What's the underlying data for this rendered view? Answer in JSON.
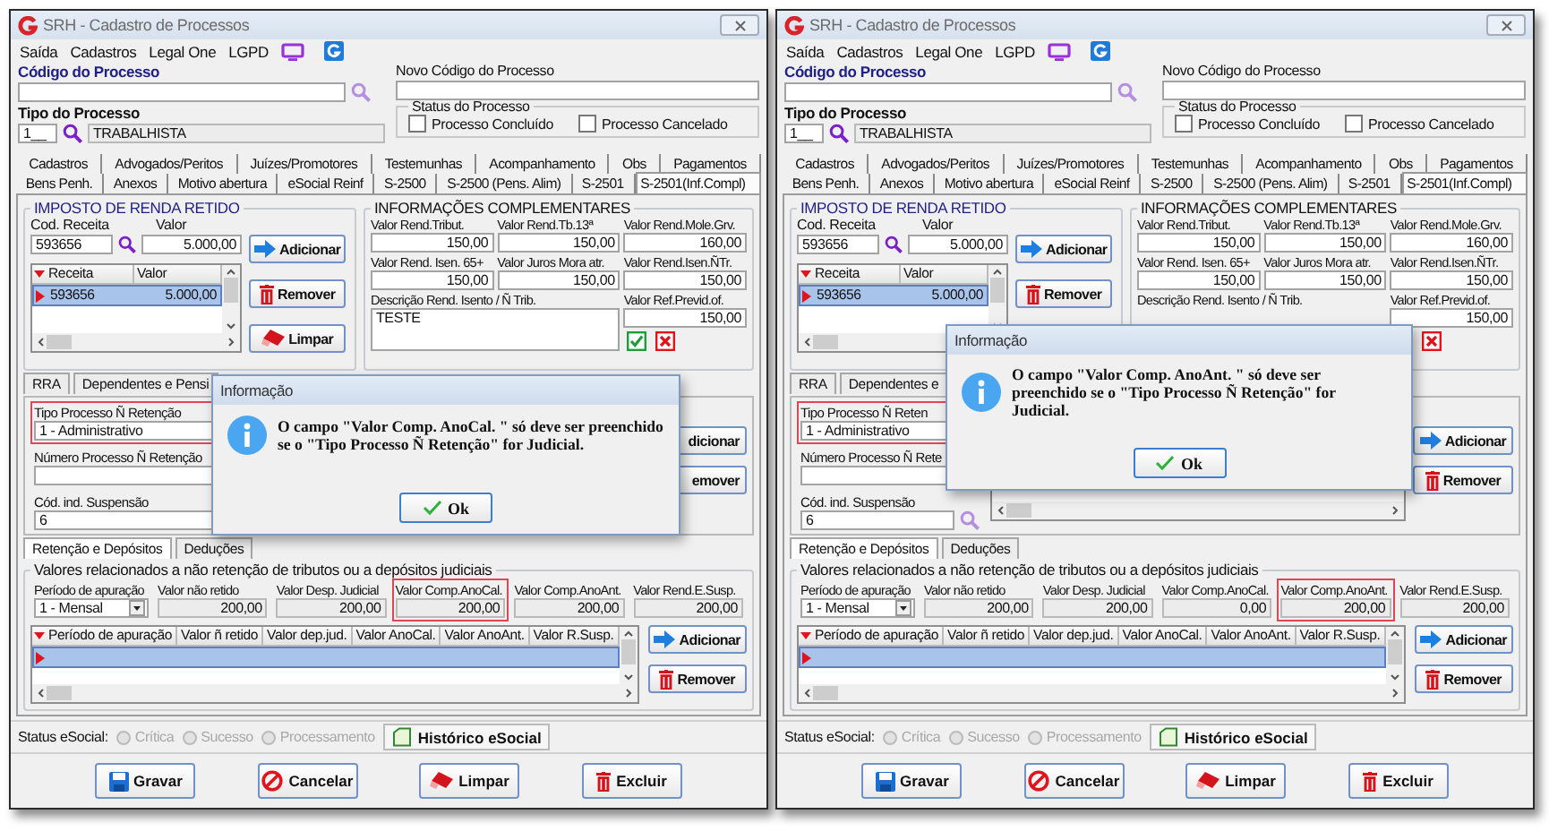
{
  "windows": [
    {
      "title": "SRH - Cadastro de Processos",
      "menu": [
        {
          "label": "Saída"
        },
        {
          "label": "Cadastros"
        },
        {
          "label": "Legal One"
        },
        {
          "label": "LGPD"
        }
      ],
      "process_code": {
        "label": "Código do Processo"
      },
      "new_code": {
        "label": "Novo Código do Processo"
      },
      "process_type": {
        "label": "Tipo do Processo",
        "code": "1__",
        "name": "TRABALHISTA"
      },
      "status_group": {
        "title": "Status do Processo",
        "options": [
          {
            "label": "Processo Concluído",
            "checked": false
          },
          {
            "label": "Processo Cancelado",
            "checked": false
          }
        ]
      },
      "tabs": [
        [
          {
            "label": "Cadastros",
            "selected": false
          },
          {
            "label": "Advogados/Peritos",
            "selected": false
          },
          {
            "label": "Juízes/Promotores",
            "selected": false
          },
          {
            "label": "Testemunhas",
            "selected": false
          },
          {
            "label": "Acompanhamento",
            "selected": false
          },
          {
            "label": "Obs",
            "selected": false
          },
          {
            "label": "Pagamentos",
            "selected": false
          }
        ],
        [
          {
            "label": "Bens Penh.",
            "selected": false
          },
          {
            "label": "Anexos",
            "selected": false
          },
          {
            "label": "Motivo abertura",
            "selected": false
          },
          {
            "label": "eSocial Reinf",
            "selected": false
          },
          {
            "label": "S-2500",
            "selected": false
          },
          {
            "label": "S-2500 (Pens. Alim)",
            "selected": false
          },
          {
            "label": "S-2501",
            "selected": false
          },
          {
            "label": "S-2501(Inf.Compl)",
            "selected": true
          }
        ]
      ],
      "income_tax": {
        "title": "IMPOSTO DE RENDA RETIDO",
        "code_label": "Cod. Receita",
        "code": "593656",
        "value_label": "Valor",
        "value": "5.000,00",
        "columns": [
          "Receita",
          "Valor"
        ],
        "rows": [
          {
            "cells": [
              "593656",
              "5.000,00"
            ],
            "selected": true
          }
        ],
        "buttons": [
          {
            "kind": "add",
            "label": "Adicionar"
          },
          {
            "kind": "remove",
            "label": "Remover"
          },
          {
            "kind": "clear",
            "label": "Limpar"
          }
        ]
      },
      "complementary": {
        "title": "INFORMAÇÕES COMPLEMENTARES",
        "fields": [
          {
            "label": "Valor Rend.Tribut.",
            "value": "150,00"
          },
          {
            "label": "Valor Rend.Tb.13ª",
            "value": "150,00"
          },
          {
            "label": "Valor Rend.Mole.Grv.",
            "value": "160,00"
          },
          {
            "label": "Valor Rend. Isen. 65+",
            "value": "150,00"
          },
          {
            "label": "Valor Juros Mora atr.",
            "value": "150,00"
          },
          {
            "label": "Valor Rend.Isen.ÑTr.",
            "value": "150,00"
          }
        ],
        "description": {
          "label": "Descrição Rend. Isento / Ñ Trib.",
          "value": "TESTE"
        },
        "previd": {
          "label": "Valor Ref.Previd.of.",
          "value": "150,00"
        },
        "actions": [
          {
            "kind": "confirm"
          },
          {
            "kind": "cancel"
          }
        ]
      },
      "subtabs": [
        {
          "label": "RRA",
          "selected": false
        },
        {
          "label": "Dependentes e Pensi",
          "selected": false
        }
      ],
      "retention": {
        "fields": [
          {
            "label": "Tipo Processo Ñ Retenção",
            "value": "1 - Administrativo",
            "highlighted": true
          },
          {
            "label": "Número Processo Ñ Retenção",
            "highlighted": false
          },
          {
            "label": "Cód. ind. Suspensão",
            "value": "6",
            "highlighted": false
          }
        ],
        "buttons": [
          {
            "label": "dicionar"
          },
          {
            "label": "emover"
          }
        ]
      },
      "subtabs2": [
        {
          "label": "Retenção e Depósitos",
          "selected": true
        },
        {
          "label": "Deduções",
          "selected": false
        }
      ],
      "values": {
        "title": "Valores relacionados a não retenção de tributos ou a depósitos judiciais",
        "period": {
          "label": "Período de apuração",
          "value": "1 - Mensal"
        },
        "fields": [
          {
            "label": "Valor não retido",
            "value": "200,00",
            "highlighted": false
          },
          {
            "label": "Valor Desp. Judicial",
            "value": "200,00",
            "highlighted": false
          },
          {
            "label": "Valor Comp.AnoCal.",
            "value": "200,00",
            "highlighted": true
          },
          {
            "label": "Valor Comp.AnoAnt.",
            "value": "200,00",
            "highlighted": false
          },
          {
            "label": "Valor Rend.E.Susp.",
            "value": "200,00",
            "highlighted": false
          }
        ],
        "columns": [
          "Período de apuração",
          "Valor ñ retido",
          "Valor dep.jud.",
          "Valor AnoCal.",
          "Valor AnoAnt.",
          "Valor R.Susp."
        ],
        "rows": [
          {
            "selected": true
          }
        ],
        "buttons": [
          {
            "kind": "add",
            "label": "Adicionar"
          },
          {
            "kind": "remove",
            "label": "Remover"
          }
        ]
      },
      "status_bar": {
        "label": "Status eSocial:",
        "options": [
          {
            "label": "Crítica",
            "selected": false,
            "disabled": true
          },
          {
            "label": "Sucesso",
            "selected": false,
            "disabled": true
          },
          {
            "label": "Processamento",
            "selected": false,
            "disabled": true
          }
        ],
        "history_button": "Histórico eSocial"
      },
      "actions": [
        {
          "kind": "save",
          "label": "Gravar"
        },
        {
          "kind": "cancel",
          "label": "Cancelar"
        },
        {
          "kind": "clear",
          "label": "Limpar"
        },
        {
          "kind": "delete",
          "label": "Excluir"
        }
      ],
      "dialog": {
        "title": "Informação",
        "message": "O campo \"Valor Comp. AnoCal. \" só deve ser preenchido se o \"Tipo Processo Ñ Retenção\" for Judicial.",
        "button": "Ok"
      }
    },
    {
      "title": "SRH - Cadastro de Processos",
      "menu": [
        {
          "label": "Saída"
        },
        {
          "label": "Cadastros"
        },
        {
          "label": "Legal One"
        },
        {
          "label": "LGPD"
        }
      ],
      "process_code": {
        "label": "Código do Processo"
      },
      "new_code": {
        "label": "Novo Código do Processo"
      },
      "process_type": {
        "label": "Tipo do Processo",
        "code": "1__",
        "name": "TRABALHISTA"
      },
      "status_group": {
        "title": "Status do Processo",
        "options": [
          {
            "label": "Processo Concluído",
            "checked": false
          },
          {
            "label": "Processo Cancelado",
            "checked": false
          }
        ]
      },
      "tabs": [
        [
          {
            "label": "Cadastros",
            "selected": false
          },
          {
            "label": "Advogados/Peritos",
            "selected": false
          },
          {
            "label": "Juízes/Promotores",
            "selected": false
          },
          {
            "label": "Testemunhas",
            "selected": false
          },
          {
            "label": "Acompanhamento",
            "selected": false
          },
          {
            "label": "Obs",
            "selected": false
          },
          {
            "label": "Pagamentos",
            "selected": false
          }
        ],
        [
          {
            "label": "Bens Penh.",
            "selected": false
          },
          {
            "label": "Anexos",
            "selected": false
          },
          {
            "label": "Motivo abertura",
            "selected": false
          },
          {
            "label": "eSocial Reinf",
            "selected": false
          },
          {
            "label": "S-2500",
            "selected": false
          },
          {
            "label": "S-2500 (Pens. Alim)",
            "selected": false
          },
          {
            "label": "S-2501",
            "selected": false
          },
          {
            "label": "S-2501(Inf.Compl)",
            "selected": true
          }
        ]
      ],
      "income_tax": {
        "title": "IMPOSTO DE RENDA RETIDO",
        "code_label": "Cod. Receita",
        "code": "593656",
        "value_label": "Valor",
        "value": "5.000,00",
        "columns": [
          "Receita",
          "Valor"
        ],
        "rows": [
          {
            "cells": [
              "593656",
              "5.000,00"
            ],
            "selected": true
          }
        ],
        "buttons": [
          {
            "kind": "add",
            "label": "Adicionar"
          },
          {
            "kind": "remove",
            "label": "Remover"
          }
        ]
      },
      "complementary": {
        "title": "INFORMAÇÕES COMPLEMENTARES",
        "fields": [
          {
            "label": "Valor Rend.Tribut.",
            "value": "150,00"
          },
          {
            "label": "Valor Rend.Tb.13ª",
            "value": "150,00"
          },
          {
            "label": "Valor Rend.Mole.Grv.",
            "value": "160,00"
          },
          {
            "label": "Valor Rend. Isen. 65+",
            "value": "150,00"
          },
          {
            "label": "Valor Juros Mora atr.",
            "value": "150,00"
          },
          {
            "label": "Valor Rend.Isen.ÑTr.",
            "value": "150,00"
          }
        ],
        "description": {
          "label": "Descrição Rend. Isento / Ñ Trib."
        },
        "previd": {
          "label": "Valor Ref.Previd.of.",
          "value": "150,00"
        },
        "actions": [
          {
            "kind": "cancel"
          }
        ]
      },
      "subtabs": [
        {
          "label": "RRA",
          "selected": false
        },
        {
          "label": "Dependentes e",
          "selected": false
        }
      ],
      "retention": {
        "fields": [
          {
            "label": "Tipo Processo Ñ Reten",
            "value": "1 - Administrativo",
            "highlighted": true
          },
          {
            "label": "Número Processo Ñ Rete",
            "highlighted": false
          },
          {
            "label": "Cód. ind. Suspensão",
            "value": "6",
            "highlighted": false,
            "lookup": true
          }
        ],
        "buttons": [
          {
            "kind": "add",
            "label": "Adicionar"
          },
          {
            "kind": "remove",
            "label": "Remover"
          }
        ]
      },
      "subtabs2": [
        {
          "label": "Retenção e Depósitos",
          "selected": true
        },
        {
          "label": "Deduções",
          "selected": false
        }
      ],
      "values": {
        "title": "Valores relacionados a não retenção de tributos ou a depósitos judiciais",
        "period": {
          "label": "Período de apuração",
          "value": "1 - Mensal"
        },
        "fields": [
          {
            "label": "Valor não retido",
            "value": "200,00",
            "highlighted": false
          },
          {
            "label": "Valor Desp. Judicial",
            "value": "200,00",
            "highlighted": false
          },
          {
            "label": "Valor Comp.AnoCal.",
            "value": "0,00",
            "highlighted": false
          },
          {
            "label": "Valor Comp.AnoAnt.",
            "value": "200,00",
            "highlighted": true
          },
          {
            "label": "Valor Rend.E.Susp.",
            "value": "200,00",
            "highlighted": false
          }
        ],
        "columns": [
          "Período de apuração",
          "Valor ñ retido",
          "Valor dep.jud.",
          "Valor AnoCal.",
          "Valor AnoAnt.",
          "Valor R.Susp."
        ],
        "rows": [
          {
            "selected": true
          }
        ],
        "buttons": [
          {
            "kind": "add",
            "label": "Adicionar"
          },
          {
            "kind": "remove",
            "label": "Remover"
          }
        ]
      },
      "status_bar": {
        "label": "Status eSocial:",
        "options": [
          {
            "label": "Crítica",
            "selected": false,
            "disabled": true
          },
          {
            "label": "Sucesso",
            "selected": false,
            "disabled": true
          },
          {
            "label": "Processamento",
            "selected": false,
            "disabled": true
          }
        ],
        "history_button": "Histórico eSocial"
      },
      "actions": [
        {
          "kind": "save",
          "label": "Gravar"
        },
        {
          "kind": "cancel",
          "label": "Cancelar"
        },
        {
          "kind": "clear",
          "label": "Limpar"
        },
        {
          "kind": "delete",
          "label": "Excluir"
        }
      ],
      "dialog": {
        "title": "Informação",
        "message": "O campo \"Valor Comp. AnoAnt. \" só deve ser preenchido se o \"Tipo Processo Ñ Retenção\" for Judicial.",
        "button": "Ok"
      }
    }
  ]
}
